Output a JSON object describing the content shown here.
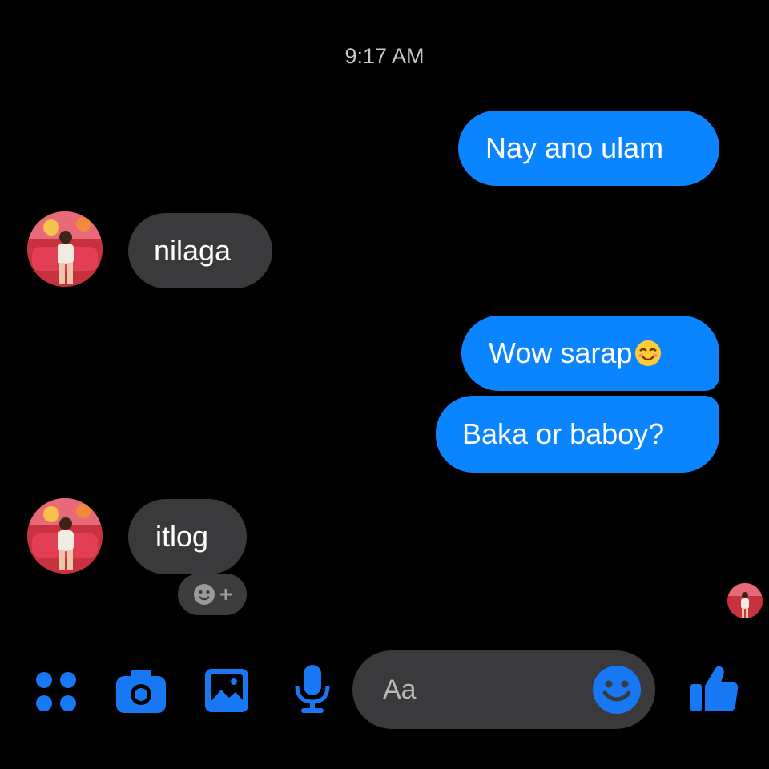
{
  "header": {
    "timestamp": "9:17 AM"
  },
  "messages": [
    {
      "text": "Nay ano ulam",
      "direction": "outgoing"
    },
    {
      "text": "nilaga",
      "direction": "incoming"
    },
    {
      "text": "Wow sarap",
      "direction": "outgoing",
      "emoji": "smiling-face-with-smiling-eyes"
    },
    {
      "text": "Baka or baboy?",
      "direction": "outgoing"
    },
    {
      "text": "itlog",
      "direction": "incoming"
    }
  ],
  "reaction_button": {
    "icon": "add-reaction-icon",
    "label": "+"
  },
  "toolbar": {
    "icons": [
      "apps-icon",
      "camera-icon",
      "gallery-icon",
      "microphone-icon",
      "emoji-icon",
      "thumbs-up-icon"
    ]
  },
  "composer": {
    "placeholder": "Aa"
  },
  "colors": {
    "background": "#000000",
    "outgoing_bubble": "#0a84ff",
    "incoming_bubble": "#3a3a3c",
    "accent": "#1877f2"
  }
}
